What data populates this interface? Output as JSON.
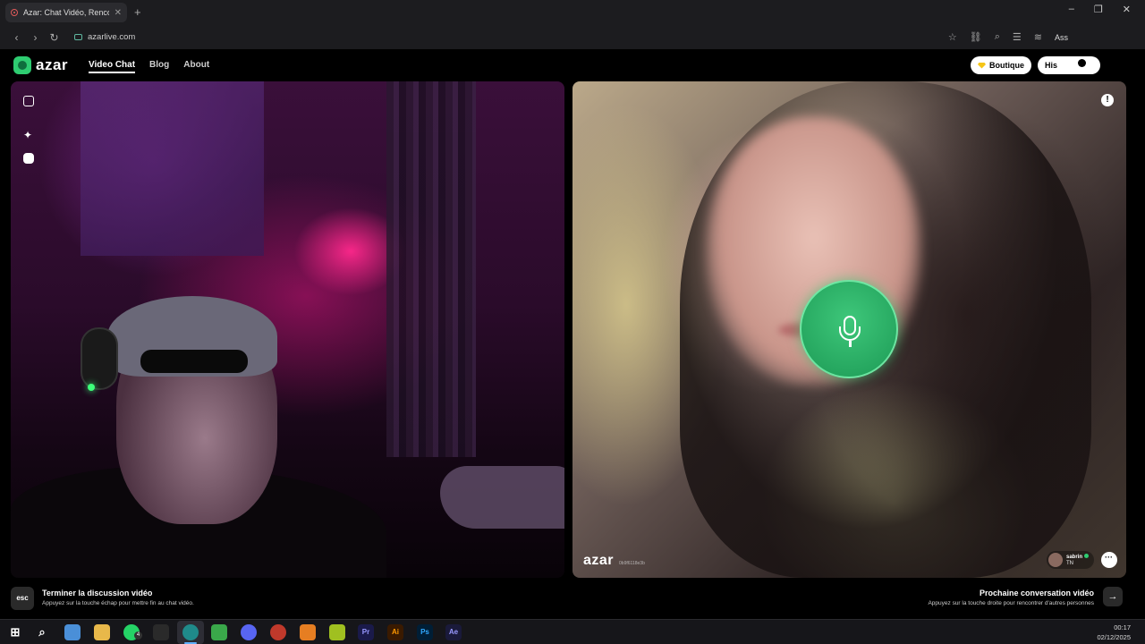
{
  "browser": {
    "tab_title": "Azar: Chat Vidéo, Rencontrer",
    "new_tab": "+",
    "url": "azarlive.com",
    "assistant_label": "Ass"
  },
  "header": {
    "logo_text": "azar",
    "nav": {
      "video_chat": "Video Chat",
      "blog": "Blog",
      "about": "About"
    },
    "boutique_label": "Boutique",
    "history_label": "His"
  },
  "local_video": {
    "icons": [
      "expand-icon",
      "sparkle-effects-icon",
      "face-filter-icon"
    ]
  },
  "remote_video": {
    "watermark": "azar",
    "watermark_id": "0b9f6118e3b",
    "peer_name": "sabrin",
    "peer_country": "TN",
    "colors": {
      "mic_green": "#1c9a55",
      "online": "#2ecc71"
    }
  },
  "hints": {
    "esc_key": "esc",
    "end_title": "Terminer la discussion vidéo",
    "end_sub": "Appuyez sur la touche échap pour mettre fin au chat vidéo.",
    "next_title": "Prochaine conversation vidéo",
    "next_sub": "Appuyez sur la touche droite pour rencontrer d'autres personnes",
    "next_arrow": "→"
  },
  "taskbar": {
    "whatsapp_badge": "4",
    "apps": {
      "premiere": "Pr",
      "illustrator": "Ai",
      "photoshop": "Ps",
      "after_effects": "Ae"
    },
    "time": "00:17",
    "date": "02/12/2025"
  }
}
